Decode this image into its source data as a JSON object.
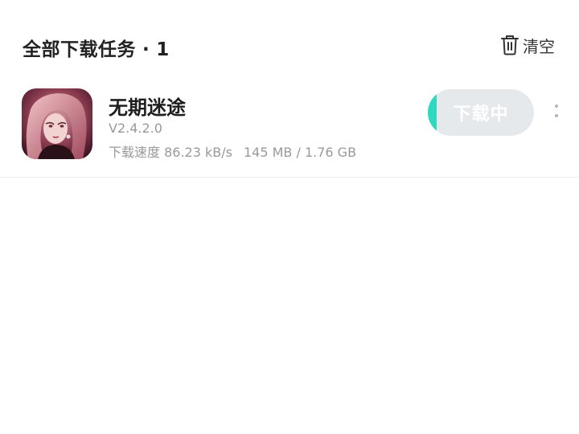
{
  "header": {
    "title": "全部下载任务",
    "separator": "·",
    "count": "1",
    "clear_icon": "trash-icon",
    "clear_label": "清空"
  },
  "tasks": [
    {
      "name": "无期迷途",
      "version": "V2.4.2.0",
      "speed_label": "下载速度",
      "speed": "86.23 kB/s",
      "downloaded": "145 MB",
      "size_separator": "/",
      "total": "1.76 GB",
      "progress": 0.082,
      "button_label": "下载中",
      "more_icon": "more-vertical-icon"
    }
  ],
  "colors": {
    "progress_fill": "#2ed9c0",
    "button_track": "#e6e9ec",
    "secondary_text": "#999999"
  }
}
